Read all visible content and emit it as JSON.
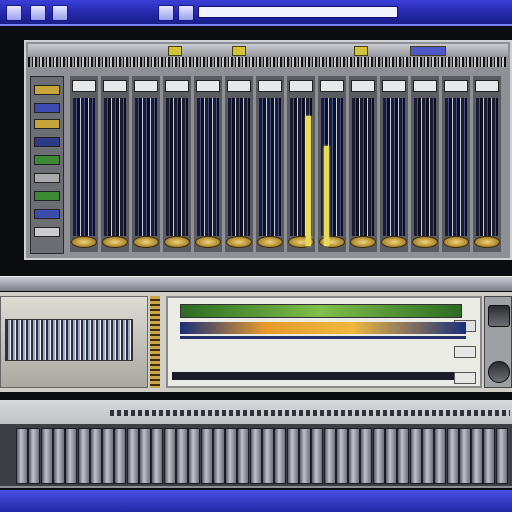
{
  "titlebar": {
    "buttons": [
      "",
      "",
      ""
    ],
    "address_value": ""
  },
  "mixer": {
    "channel_count": 14,
    "highlight_colors": {
      "tab": "#d2c43a",
      "meter": "#e9d95a",
      "knob": "#c9a13c"
    }
  },
  "icons": {
    "titlebar": [
      "app-icon",
      "menu-icon",
      "menu-icon",
      "home-icon",
      "refresh-icon"
    ],
    "right_panel": [
      "power-icon",
      "dial-icon"
    ]
  },
  "status": {
    "text": ""
  }
}
